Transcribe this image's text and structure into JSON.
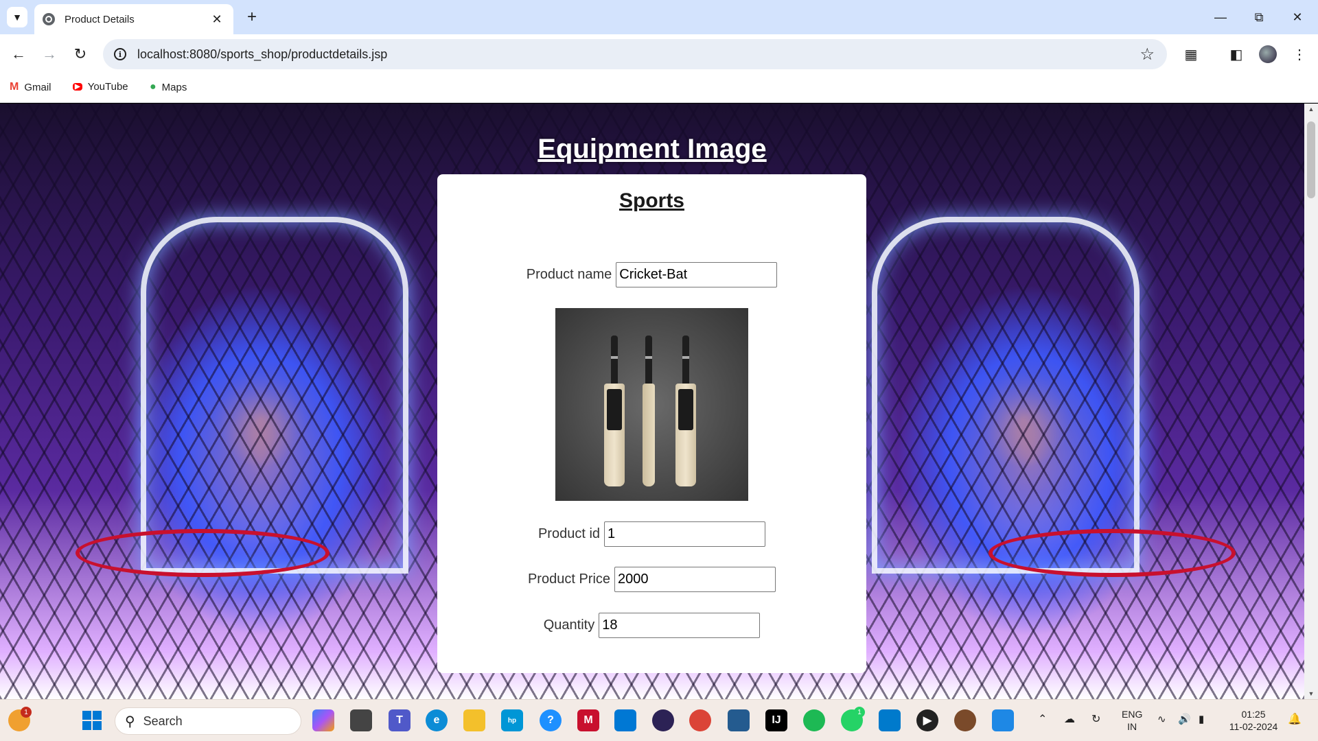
{
  "browser": {
    "tab_title": "Product Details",
    "url": "localhost:8080/sports_shop/productdetails.jsp",
    "bookmarks": [
      {
        "label": "Gmail",
        "icon": "gmail-icon"
      },
      {
        "label": "YouTube",
        "icon": "youtube-icon"
      },
      {
        "label": "Maps",
        "icon": "maps-icon"
      }
    ]
  },
  "page": {
    "title": "Equipment Image",
    "card_title": "Sports",
    "fields": {
      "product_name": {
        "label": "Product name",
        "value": "Cricket-Bat"
      },
      "product_id": {
        "label": "Product id",
        "value": "1"
      },
      "product_price": {
        "label": "Product Price",
        "value": "2000"
      },
      "quantity": {
        "label": "Quantity",
        "value": "18"
      }
    },
    "product_image": "cricket-bat-image"
  },
  "taskbar": {
    "search_label": "Search",
    "language": "ENG",
    "region": "IN",
    "time": "01:25",
    "date": "11-02-2024",
    "weather_badge": "1",
    "whatsapp_badge": "1"
  },
  "colors": {
    "tabstrip": "#d3e3fd",
    "omnibox": "#e9eef6",
    "taskbar": "#f3ebe6",
    "card": "#ffffff"
  }
}
